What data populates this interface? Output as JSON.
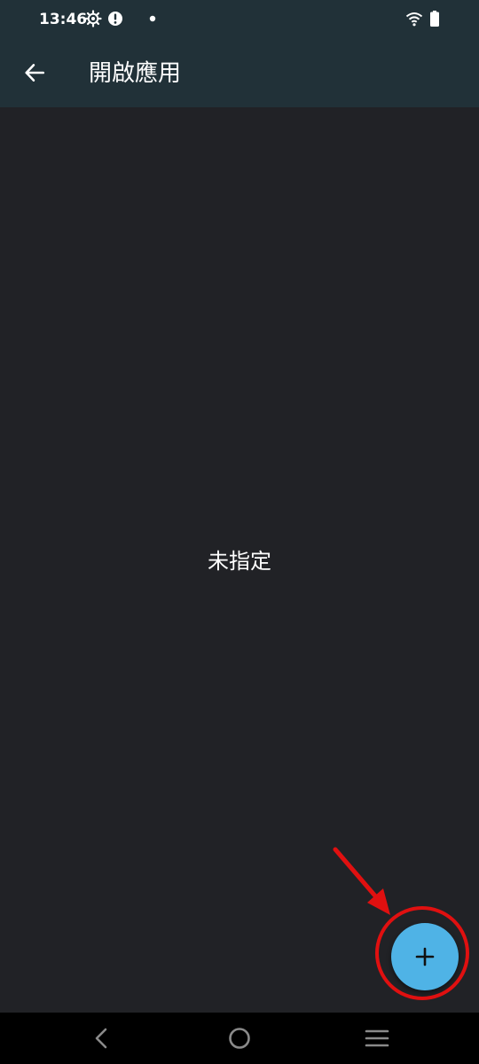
{
  "status_bar": {
    "time": "13:46",
    "icons": [
      "settings-gear-icon",
      "alert-icon",
      "notification-dot-icon",
      "wifi-icon",
      "battery-icon"
    ]
  },
  "app_bar": {
    "title": "開啟應用",
    "back_icon": "arrow-left-icon",
    "background": "#213138"
  },
  "content": {
    "empty_text": "未指定",
    "background": "#212226"
  },
  "fab": {
    "icon": "plus-icon",
    "color": "#4fb3e6"
  },
  "annotation": {
    "color": "#e01010",
    "shapes": [
      "circle",
      "arrow"
    ]
  },
  "nav_bar": {
    "buttons": [
      "back-nav-icon",
      "home-nav-icon",
      "recents-nav-icon"
    ],
    "background": "#000000"
  }
}
